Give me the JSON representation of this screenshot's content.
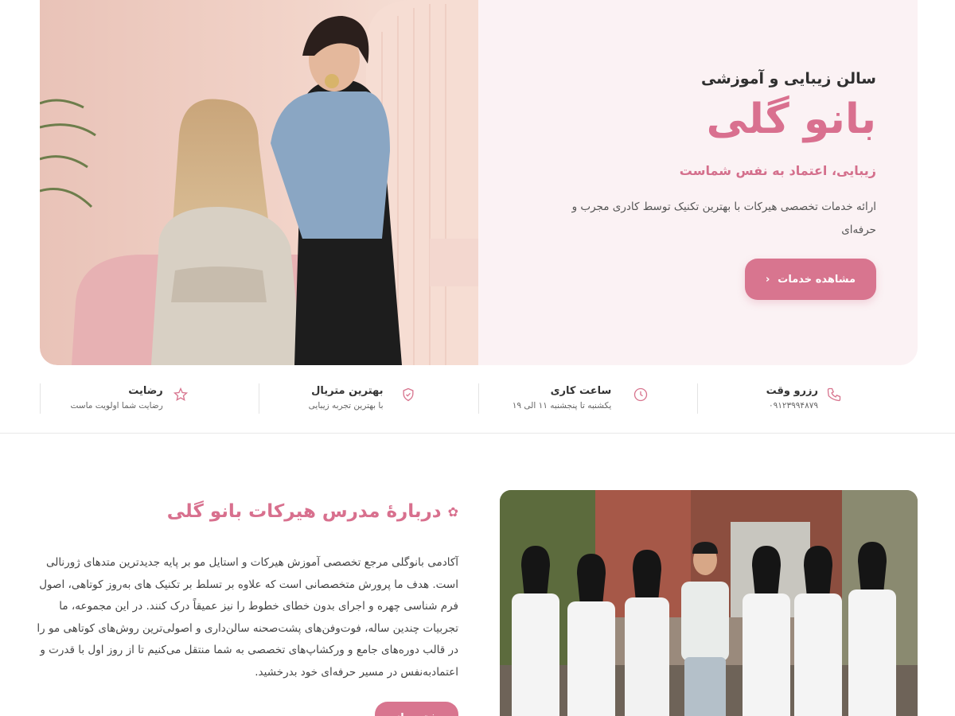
{
  "hero": {
    "subtitle": "سالن زیبایی و آموزشی",
    "title": "بانو گلی",
    "tagline": "زیبایی، اعتماد به نفس شماست",
    "description": "ارائه خدمات تخصصی هیرکات با بهترین تکنیک توسط کادری مجرب و حرفه‌ای",
    "cta_label": "مشاهده خدمات",
    "cta_icon": "chevron-left-icon"
  },
  "features": [
    {
      "title": "رزرو وقت",
      "detail": "۰۹۱۲۳۹۹۴۸۷۹",
      "icon": "phone-icon"
    },
    {
      "title": "ساعت کاری",
      "detail": "یکشنبه تا پنجشنبه ۱۱ الی ۱۹",
      "icon": "clock-icon"
    },
    {
      "title": "بهترین متریال",
      "detail": "با بهترین تجربه زیبایی",
      "icon": "shield-check-icon"
    },
    {
      "title": "رضایت",
      "detail": "رضایت شما اولویت ماست",
      "icon": "star-icon"
    }
  ],
  "about": {
    "title": "دربارهٔ مدرس هیرکات بانو گلی",
    "title_icon": "flower-icon",
    "text": "آکادمی بانوگلی مرجع تخصصی آموزش هیرکات و استایل مو بر پایه جدیدترین متدهای ژورنالی است. هدف ما پرورش متخصصانی است که علاوه بر تسلط بر تکنیک های به‌روز کوتاهی، اصول فرم شناسی چهره و اجرای بدون خطای خطوط را نیز عمیقاً درک کنند. در این مجموعه، ما تجربیات چندین ساله، فوت‌وفن‌های پشت‌صحنه سالن‌داری و اصولی‌ترین روش‌های کوتاهی مو را در قالب دوره‌های جامع و ورکشاپ‌های تخصصی به شما منتقل می‌کنیم تا از روز اول با قدرت و اعتمادبه‌نفس در مسیر حرفه‌ای خود بدرخشید.",
    "button_label": "بیشتر بدانید"
  },
  "colors": {
    "accent": "#d8758f",
    "hero_background": "#fbf2f4",
    "text": "#2b2b2b"
  }
}
